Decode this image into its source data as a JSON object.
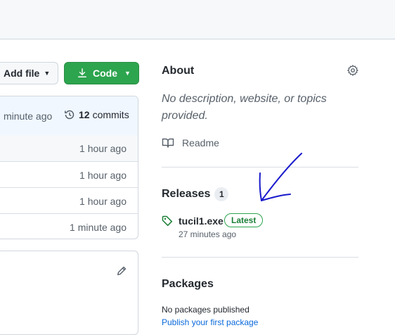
{
  "toolbar": {
    "add_file_label": "Add file",
    "code_label": "Code"
  },
  "files": {
    "latest_commit_ago": "minute ago",
    "commits_count": "12",
    "commits_label": "commits",
    "rows": [
      {
        "ago": "1 hour ago"
      },
      {
        "ago": "1 hour ago"
      },
      {
        "ago": "1 hour ago"
      },
      {
        "ago": "1 minute ago"
      }
    ]
  },
  "about": {
    "title": "About",
    "description": "No description, website, or topics provided.",
    "readme_label": "Readme"
  },
  "releases": {
    "title": "Releases",
    "count": "1",
    "latest": {
      "name": "tucil1.exe",
      "badge": "Latest",
      "time": "27 minutes ago"
    }
  },
  "packages": {
    "title": "Packages",
    "none_text": "No packages published",
    "publish_link": "Publish your first package"
  },
  "colors": {
    "primary_button": "#2da44e",
    "link": "#0969da",
    "annotation_ink": "#1a1acc"
  },
  "icons": [
    "caret-down-icon",
    "download-icon",
    "history-icon",
    "pencil-icon",
    "gear-icon",
    "book-icon",
    "tag-icon",
    "hand-drawn-arrow"
  ]
}
